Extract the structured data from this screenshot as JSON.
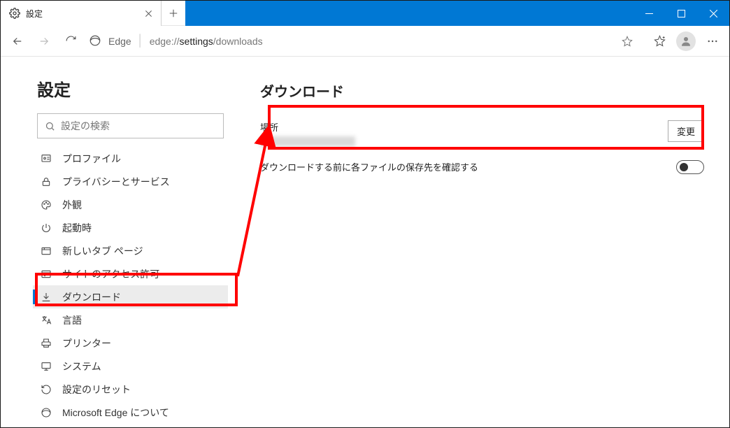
{
  "tab": {
    "title": "設定"
  },
  "address": {
    "edge_label": "Edge",
    "url_prefix": "edge://",
    "url_dark": "settings",
    "url_suffix": "/downloads"
  },
  "sidebar": {
    "heading": "設定",
    "search_placeholder": "設定の検索",
    "items": [
      {
        "label": "プロファイル",
        "icon": "profile"
      },
      {
        "label": "プライバシーとサービス",
        "icon": "lock"
      },
      {
        "label": "外観",
        "icon": "palette"
      },
      {
        "label": "起動時",
        "icon": "power"
      },
      {
        "label": "新しいタブ ページ",
        "icon": "newtab"
      },
      {
        "label": "サイトのアクセス許可",
        "icon": "permissions"
      },
      {
        "label": "ダウンロード",
        "icon": "download",
        "active": true
      },
      {
        "label": "言語",
        "icon": "language"
      },
      {
        "label": "プリンター",
        "icon": "printer"
      },
      {
        "label": "システム",
        "icon": "system"
      },
      {
        "label": "設定のリセット",
        "icon": "reset"
      },
      {
        "label": "Microsoft Edge について",
        "icon": "edge"
      }
    ]
  },
  "main": {
    "heading": "ダウンロード",
    "location_label": "場所",
    "location_value": "████████████████",
    "change_button": "変更",
    "ask_label": "ダウンロードする前に各ファイルの保存先を確認する"
  }
}
